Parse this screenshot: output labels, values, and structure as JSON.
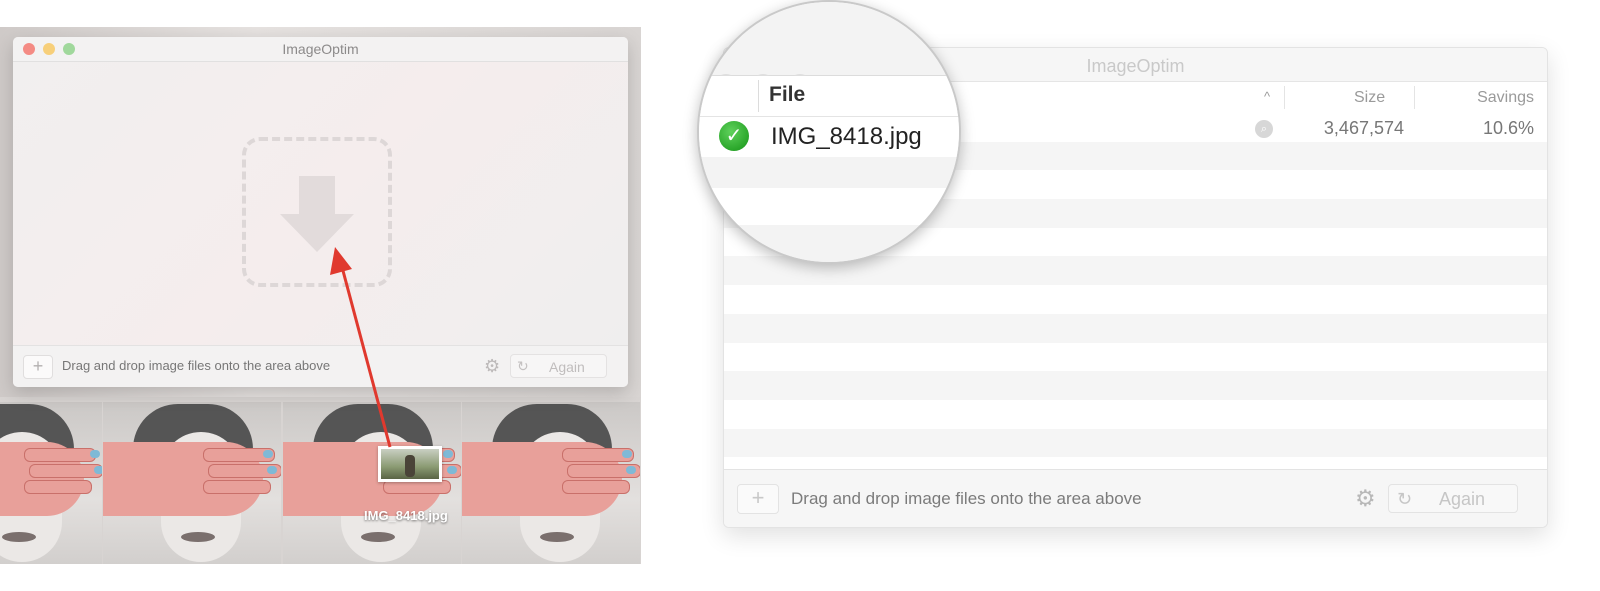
{
  "left_window": {
    "title": "ImageOptim",
    "hint": "Drag and drop image files onto the area above",
    "add_label": "+",
    "again_label": "Again"
  },
  "dragged_file": {
    "name": "IMG_8418.jpg"
  },
  "right_window": {
    "title": "ImageOptim",
    "columns": {
      "file": "File",
      "size": "Size",
      "savings": "Savings"
    },
    "rows": [
      {
        "status": "done",
        "file": "IMG_8418.jpg",
        "size": "3,467,574",
        "savings": "10.6%"
      }
    ],
    "hint": "Drag and drop image files onto the area above",
    "add_label": "+",
    "again_label": "Again"
  },
  "colors": {
    "arrow": "#e0392e",
    "success": "#2aa62a"
  },
  "icons": {
    "check": "checkmark-icon",
    "gear": "gear-icon",
    "refresh": "refresh-icon",
    "search": "magnifier-icon",
    "drop_arrow": "download-arrow-icon"
  }
}
